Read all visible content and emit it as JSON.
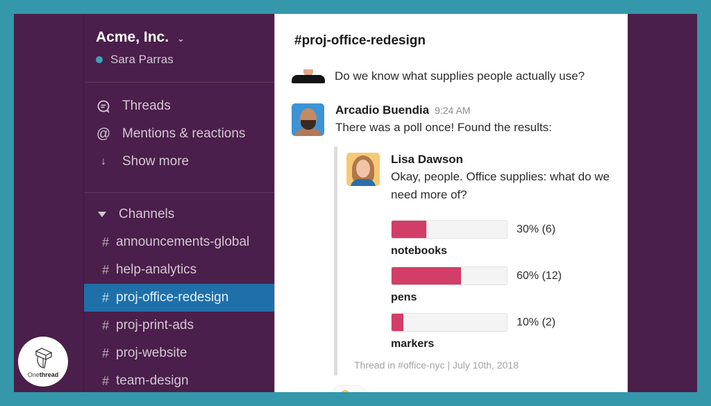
{
  "workspace": {
    "name": "Acme, Inc.",
    "user": "Sara Parras",
    "presence_color": "#3aa3b7"
  },
  "nav": [
    {
      "icon": "threads-icon",
      "label": "Threads"
    },
    {
      "icon": "at-icon",
      "label": "Mentions & reactions"
    },
    {
      "icon": "arrow-down-icon",
      "label": "Show more"
    }
  ],
  "channels": {
    "header": "Channels",
    "items": [
      {
        "name": "announcements-global",
        "active": false
      },
      {
        "name": "help-analytics",
        "active": false
      },
      {
        "name": "proj-office-redesign",
        "active": true
      },
      {
        "name": "proj-print-ads",
        "active": false
      },
      {
        "name": "proj-website",
        "active": false
      },
      {
        "name": "team-design",
        "active": false
      }
    ]
  },
  "main": {
    "channel_title": "#proj-office-redesign",
    "previous_message": "Do we know what supplies people actually use?",
    "message": {
      "author": "Arcadio Buendia",
      "time": "9:24 AM",
      "text": "There was a poll once! Found the results:"
    },
    "shared": {
      "author": "Lisa Dawson",
      "text": "Okay, people. Office supplies: what do we need more of?",
      "poll": [
        {
          "label": "notebooks",
          "percent": 30,
          "count": 6,
          "display": "30% (6)"
        },
        {
          "label": "pens",
          "percent": 60,
          "count": 12,
          "display": "60% (12)"
        },
        {
          "label": "markers",
          "percent": 10,
          "count": 2,
          "display": "10% (2)"
        }
      ],
      "meta": "Thread in #office-nyc | July 10th, 2018"
    }
  },
  "logo": {
    "prefix": "One",
    "suffix": "thread"
  },
  "colors": {
    "background": "#3597aa",
    "sidebar": "#4a1f4b",
    "active_channel": "#1f6fa8",
    "poll_fill": "#d23e67"
  }
}
